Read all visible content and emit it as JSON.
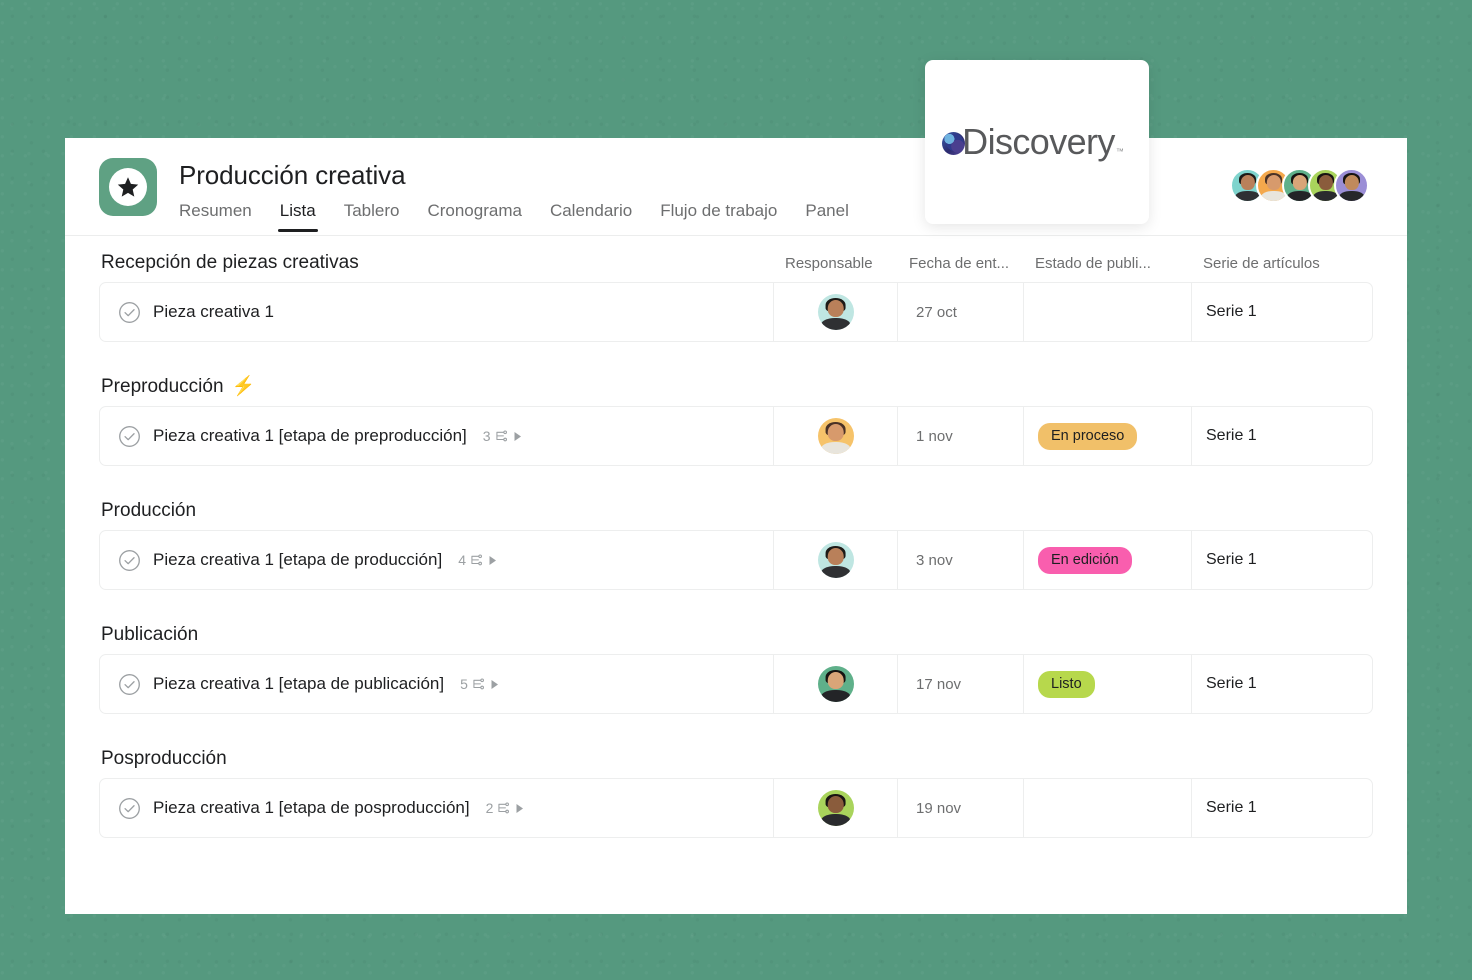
{
  "header": {
    "project_icon": "star-badge-icon",
    "title": "Producción creativa",
    "tabs": [
      {
        "label": "Resumen",
        "active": false
      },
      {
        "label": "Lista",
        "active": true
      },
      {
        "label": "Tablero",
        "active": false
      },
      {
        "label": "Cronograma",
        "active": false
      },
      {
        "label": "Calendario",
        "active": false
      },
      {
        "label": "Flujo de trabajo",
        "active": false
      },
      {
        "label": "Panel",
        "active": false
      }
    ],
    "members": [
      {
        "avatar_color": "#7fd4cd",
        "hair": "#1d1a17",
        "skin": "#b9805a",
        "shirt": "#2f3033"
      },
      {
        "avatar_color": "#f4a84c",
        "hair": "#4a3226",
        "skin": "#d79a6c",
        "shirt": "#e8e5dd"
      },
      {
        "avatar_color": "#5fb08a",
        "hair": "#161311",
        "skin": "#d9a578",
        "shirt": "#232427"
      },
      {
        "avatar_color": "#a9d45c",
        "hair": "#181412",
        "skin": "#8a5c3c",
        "shirt": "#2a2b2e"
      },
      {
        "avatar_color": "#9b8ed6",
        "hair": "#171412",
        "skin": "#c08a5c",
        "shirt": "#26272a"
      }
    ]
  },
  "columns": {
    "name": "",
    "assignee": "Responsable",
    "due_date": "Fecha de ent...",
    "publish_status": "Estado de publi...",
    "article_series": "Serie de artículos"
  },
  "sections": [
    {
      "title": "Recepción de piezas creativas",
      "emoji": "",
      "tasks": [
        {
          "name": "Pieza creativa 1",
          "subtask_count": "",
          "assignee_avatar": {
            "avatar_color": "#bfe6e2",
            "hair": "#1d1a17",
            "skin": "#b9805a",
            "shirt": "#2f3033"
          },
          "due_date": "27 oct",
          "status": "",
          "status_bg": "",
          "series": "Serie 1"
        }
      ]
    },
    {
      "title": "Preproducción",
      "emoji": "⚡",
      "tasks": [
        {
          "name": "Pieza creativa 1 [etapa de preproducción]",
          "subtask_count": "3",
          "assignee_avatar": {
            "avatar_color": "#f6c36a",
            "hair": "#4a3226",
            "skin": "#d79a6c",
            "shirt": "#e8e5dd"
          },
          "due_date": "1 nov",
          "status": "En proceso",
          "status_bg": "#f1c069",
          "series": "Serie 1"
        }
      ]
    },
    {
      "title": "Producción",
      "emoji": "",
      "tasks": [
        {
          "name": "Pieza creativa 1 [etapa de producción]",
          "subtask_count": "4",
          "assignee_avatar": {
            "avatar_color": "#bfe6e2",
            "hair": "#1d1a17",
            "skin": "#b9805a",
            "shirt": "#2f3033"
          },
          "due_date": "3 nov",
          "status": "En edición",
          "status_bg": "#f95eae",
          "series": "Serie 1"
        }
      ]
    },
    {
      "title": "Publicación",
      "emoji": "",
      "tasks": [
        {
          "name": "Pieza creativa 1 [etapa de publicación]",
          "subtask_count": "5",
          "assignee_avatar": {
            "avatar_color": "#5fb08a",
            "hair": "#161311",
            "skin": "#d9a578",
            "shirt": "#232427"
          },
          "due_date": "17 nov",
          "status": "Listo",
          "status_bg": "#b7d84c",
          "series": "Serie 1"
        }
      ]
    },
    {
      "title": "Posproducción",
      "emoji": "",
      "tasks": [
        {
          "name": "Pieza creativa 1 [etapa de posproducción]",
          "subtask_count": "2",
          "assignee_avatar": {
            "avatar_color": "#a9d45c",
            "hair": "#181412",
            "skin": "#8a5c3c",
            "shirt": "#2a2b2e"
          },
          "due_date": "19 nov",
          "status": "",
          "status_bg": "",
          "series": "Serie 1"
        }
      ]
    }
  ],
  "overlay_card": {
    "logo_text": "Discovery",
    "trademark": "™",
    "globe_icon": "globe-icon"
  },
  "colors": {
    "background": "#55997f",
    "project_icon": "#5fa183",
    "status_in_progress": "#f1c069",
    "status_editing": "#f95eae",
    "status_ready": "#b7d84c",
    "active_tab_underline": "#1e1f21"
  }
}
